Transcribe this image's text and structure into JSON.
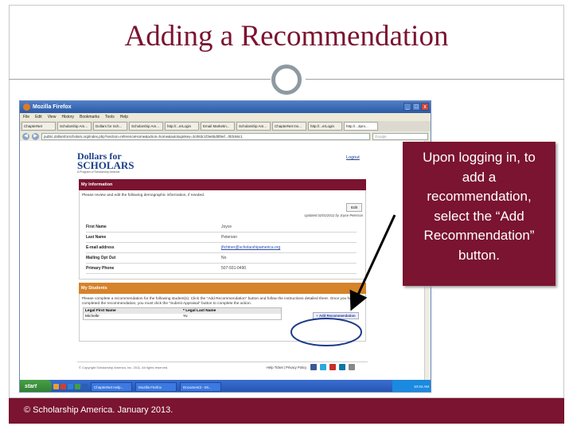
{
  "slide": {
    "title": "Adding a Recommendation",
    "callout_lines": [
      "Upon logging in, to",
      "add a",
      "recommendation,",
      "select the “Add",
      "Recommendation”",
      "button."
    ],
    "footer": "© Scholarship America. January 2013.",
    "accent_color": "#7a1430"
  },
  "browser": {
    "window_title": "Mozilla Firefox",
    "menu": [
      "File",
      "Edit",
      "View",
      "History",
      "Bookmarks",
      "Tools",
      "Help"
    ],
    "tabs": [
      "ChapterNet",
      "Scholarship Am...",
      "Dollars for Sch...",
      "Scholarship Am...",
      "http://...erLogin",
      "Email Marketin...",
      "Scholarship Am...",
      "ChapterNet Ins...",
      "http://...erLogin",
      "http://...3pro..."
    ],
    "url": "public.dollarsforscholars.org/index.php?section=referenceHome&action=home&autologinkey=3c063c1f3e6bd0f6ef...0fdc66c1",
    "search_placeholder": "Google",
    "win_buttons": [
      "_",
      "□",
      "x"
    ]
  },
  "page": {
    "logo": {
      "line1": "Dollars for",
      "line2": "SCHOLARS",
      "line3": "A Program of Scholarship America"
    },
    "logout": "Logout",
    "info": {
      "header": "My Information",
      "intro": "Please review and edit the following demographic information, if needed.",
      "edit_label": "Edit",
      "updated": "Updated 02/01/2012 by Joyce Peterson",
      "rows": [
        {
          "label": "First Name",
          "value": "Joyce"
        },
        {
          "label": "Last Name",
          "value": "Peterson"
        },
        {
          "label": "E-mail address",
          "value": "jfichtner@scholarshipamerica.org"
        },
        {
          "label": "Mailing Opt Out",
          "value": "No"
        },
        {
          "label": "Primary Phone",
          "value": "507-931-0490"
        }
      ]
    },
    "students": {
      "header": "My Students",
      "intro": "Please complete a recommendation for the following student(s). Click the \"Add Recommendation\" button and follow the instructions detailed there. Once you have completed the recommendation, you must click the \"Submit Appraisal\" button to complete the action.",
      "columns": [
        "Legal First Name",
        "* Legal Last Name"
      ],
      "rows": [
        {
          "first": "Michelle",
          "last": "Yu"
        }
      ],
      "add_button": "Add Recommendation"
    },
    "copyright": "© Copyright Scholarship America, Inc. 2011. All rights reserved.",
    "footer_links": "Help Ticket  |  Privacy Policy"
  },
  "taskbar": {
    "start": "start",
    "tasks": [
      "ChapterNet Help...",
      "Mozilla Firefox",
      "Document3 - Mi..."
    ],
    "clock": "10:34 AM"
  }
}
